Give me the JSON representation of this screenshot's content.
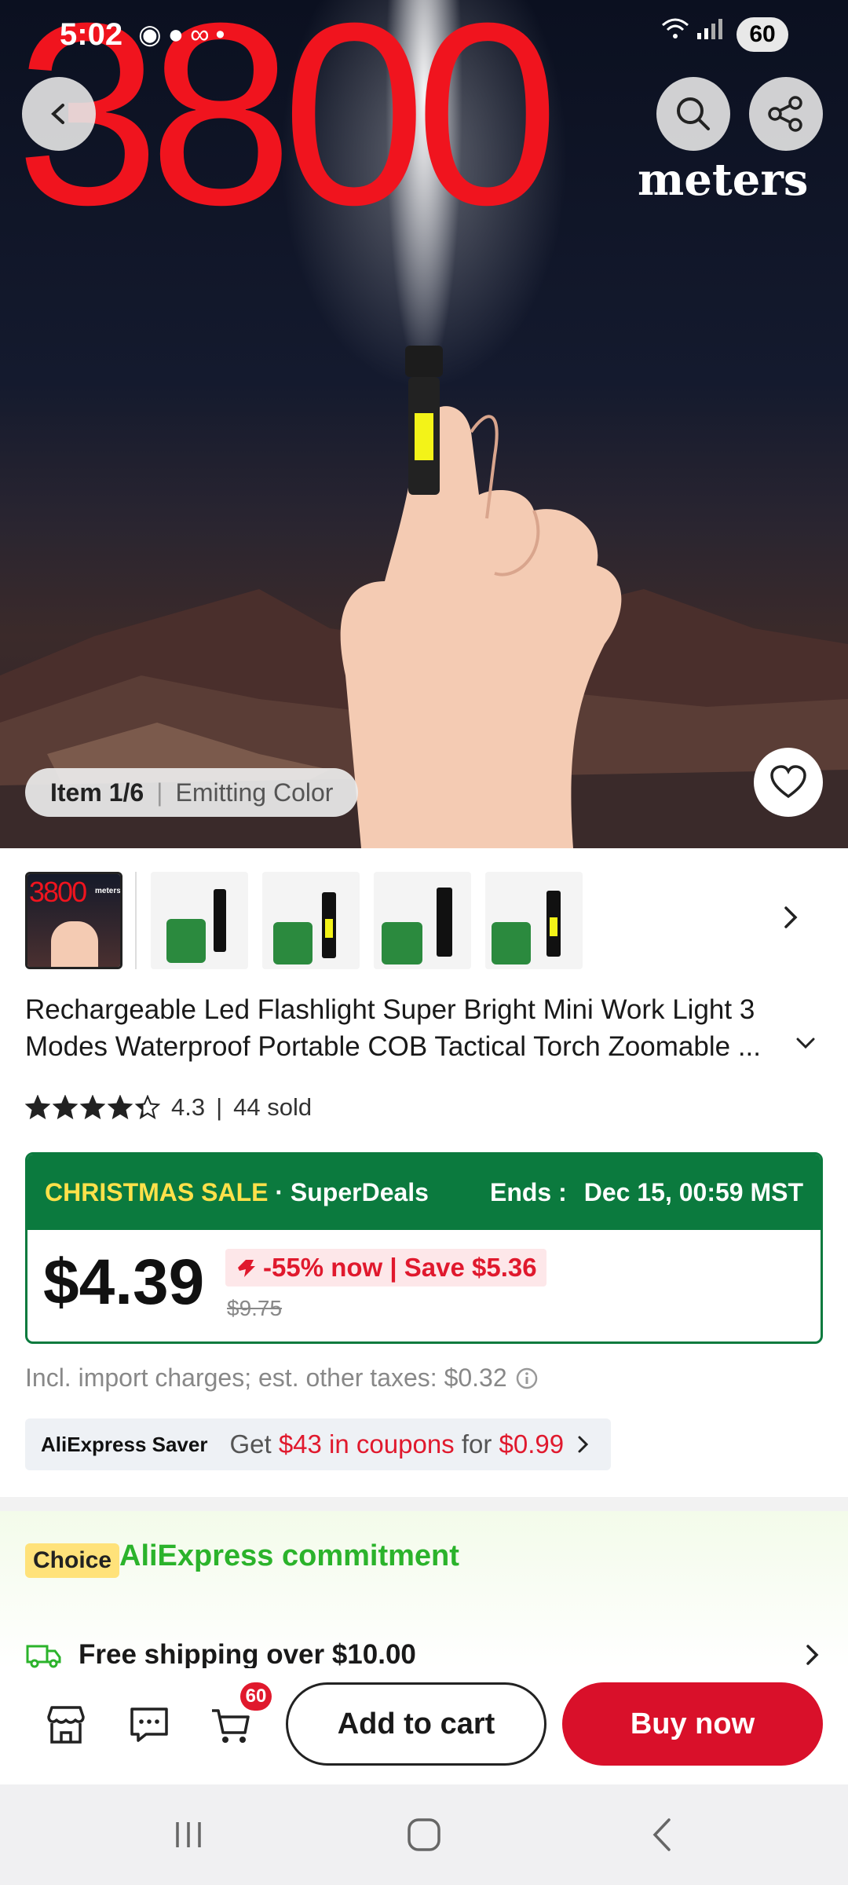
{
  "status_bar": {
    "time": "5:02",
    "left_icons": "messenger-icon, app-icon, voicemail-icon, dot",
    "battery": "60"
  },
  "hero": {
    "big_text": "3800",
    "unit_text": "meters",
    "item_label": "Item 1/6",
    "variant_label": "Emitting Color"
  },
  "thumbnails": {
    "thumb1_text": "3800",
    "thumb1_small": "meters",
    "count": 5
  },
  "product": {
    "title": "Rechargeable Led Flashlight Super Bright Mini Work Light 3 Modes Waterproof Portable COB Tactical Torch Zoomable ...",
    "rating": "4.3",
    "rating_stars": 4.3,
    "sold": "44 sold"
  },
  "deal": {
    "sale_label": "CHRISTMAS SALE",
    "dot": " · ",
    "superdeals": "SuperDeals",
    "ends_label": "Ends :",
    "ends_value": "Dec 15, 00:59 MST",
    "price": "$4.39",
    "discount": "-55% now | Save $5.36",
    "original_price": "$9.75"
  },
  "taxes": {
    "text": "Incl. import charges; est. other taxes: $0.32"
  },
  "saver": {
    "brand": "AliExpress Saver",
    "prefix": "Get ",
    "coupons": "$43 in coupons",
    "mid": " for ",
    "price": "$0.99"
  },
  "choice": {
    "badge": "Choice",
    "commitment": "AliExpress commitment",
    "shipping": "Free shipping over $10.00"
  },
  "bottom_bar": {
    "cart_count": "60",
    "add_to_cart": "Add to cart",
    "buy_now": "Buy now"
  },
  "colors": {
    "brand_red": "#d9102a",
    "deal_green": "#0b7a3e",
    "sale_yellow": "#ffe14a",
    "choice_green": "#2bb32b"
  }
}
